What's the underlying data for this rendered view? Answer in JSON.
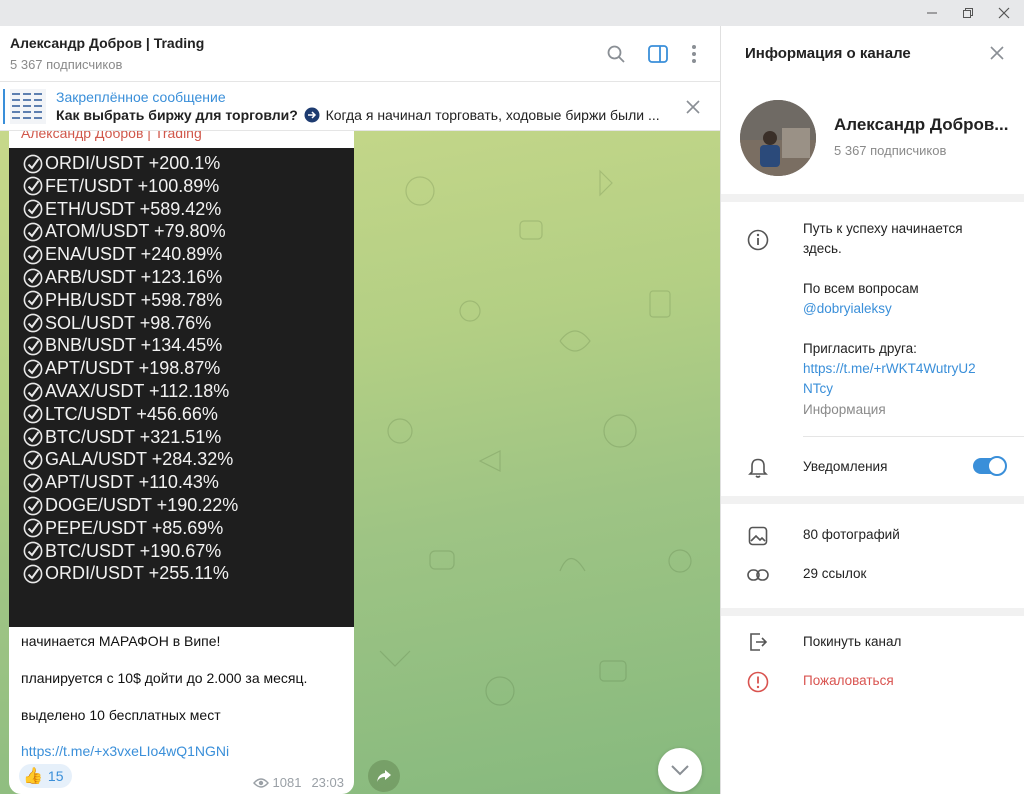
{
  "chat": {
    "title": "Александр Добров | Trading",
    "subtitle": "5 367 подписчиков"
  },
  "pinned": {
    "label": "Закреплённое сообщение",
    "text_bold": "Как выбрать биржу для торговли?",
    "text_rest": " Когда я начинал торговать, ходовые биржи были ..."
  },
  "message": {
    "author": "Александр Добров | Trading",
    "trades": [
      "ORDI/USDT +200.1%",
      "FET/USDT +100.89%",
      "ETH/USDT +589.42%",
      "ATOM/USDT +79.80%",
      "ENA/USDT +240.89%",
      "ARB/USDT +123.16%",
      "PHB/USDT +598.78%",
      "SOL/USDT +98.76%",
      "BNB/USDT +134.45%",
      "APT/USDT +198.87%",
      "AVAX/USDT +112.18%",
      "LTC/USDT +456.66%",
      "BTC/USDT +321.51%",
      "GALA/USDT +284.32%",
      "APT/USDT +110.43%",
      "DOGE/USDT +190.22%",
      "PEPE/USDT +85.69%",
      "BTC/USDT +190.67%",
      "ORDI/USDT +255.11%"
    ],
    "line1": "начинается МАРАФОН в Випе!",
    "line2": "планируется с 10$ дойти до 2.000 за месяц.",
    "line3": "выделено 10 бесплатных мест",
    "link": "https://t.me/+x3vxeLIo4wQ1NGNi",
    "reaction_emoji": "👍",
    "reaction_count": "15",
    "views": "1081",
    "time": "23:03"
  },
  "panel": {
    "title": "Информация о канале",
    "channel_name": "Александр Добров...",
    "subscribers": "5 367 подписчиков",
    "desc_line1": "Путь к успеху начинается",
    "desc_line2": "здесь.",
    "desc_line3": "По всем вопросам",
    "desc_handle": "@dobryialeksy",
    "desc_line4": "Пригласить друга:",
    "desc_link1": "https://t.me/+rWKT4WutryU2",
    "desc_link2": "NTcy",
    "info_label": "Информация",
    "notifications": "Уведомления",
    "photos": "80 фотографий",
    "links": "29 ссылок",
    "leave": "Покинуть канал",
    "report": "Пожаловаться"
  },
  "colors": {
    "accent": "#3a8fd9",
    "author": "#d0574a",
    "danger": "#d9534f"
  }
}
